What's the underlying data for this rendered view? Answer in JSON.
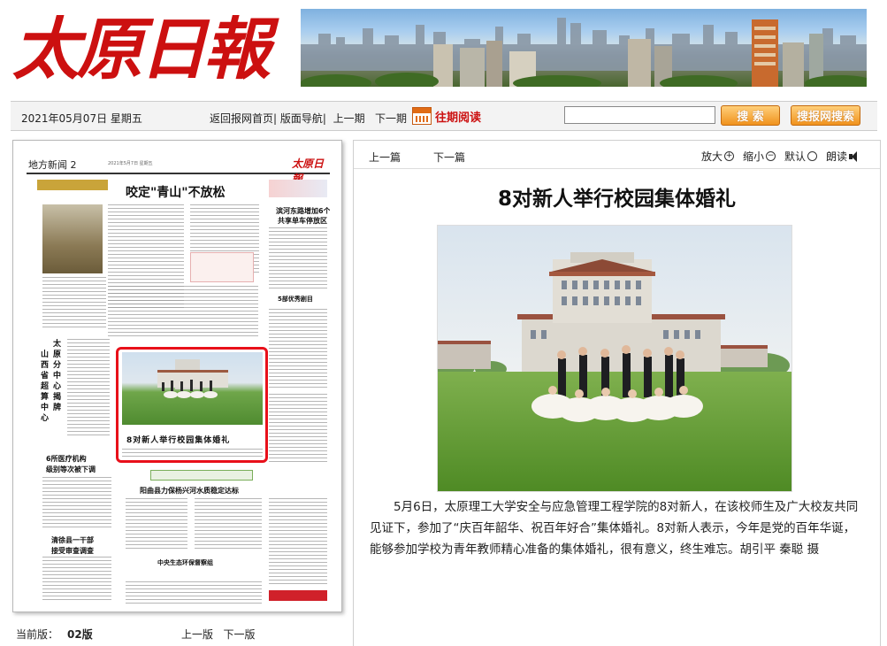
{
  "header": {
    "logo_text": "太原日報"
  },
  "nav": {
    "date": "2021年05月07日 星期五",
    "links": [
      "返回报网首页",
      "版面导航",
      "上一期",
      "下一期"
    ],
    "archive_label": "往期阅读",
    "search_placeholder": "",
    "search_button": "搜 索",
    "site_search_button": "搜报网搜索"
  },
  "thumbnail": {
    "section": "地方新闻 2",
    "meta": "2021年5月7日 星期五",
    "logo": "太原日報",
    "headline": "咬定\"青山\"不放松",
    "caption": "8对新人举行校园集体婚礼"
  },
  "page_info": {
    "label": "当前版：",
    "number": "02版",
    "prev_page": "上一版",
    "next_page": "下一版"
  },
  "article": {
    "prev": "上一篇",
    "next": "下一篇",
    "tools": {
      "zoom_in": "放大",
      "zoom_out": "缩小",
      "default": "默认",
      "read_aloud": "朗读"
    },
    "title": "8对新人举行校园集体婚礼",
    "body": "5月6日，太原理工大学安全与应急管理工程学院的8对新人，在该校师生及广大校友共同见证下，参加了“庆百年韶华、祝百年好合”集体婚礼。8对新人表示，今年是党的百年华诞，能够参加学校为青年教师精心准备的集体婚礼，很有意义，终生难忘。胡引平 秦聪 摄"
  },
  "icons": {
    "calendar": "calendar-icon",
    "zoom_in": "plus-circle-icon",
    "zoom_out": "minus-circle-icon",
    "default": "circle-icon",
    "speaker": "speaker-icon"
  },
  "colors": {
    "brand_red": "#cc1010",
    "highlight": "#e8101a",
    "button_orange": "#f0921d"
  }
}
